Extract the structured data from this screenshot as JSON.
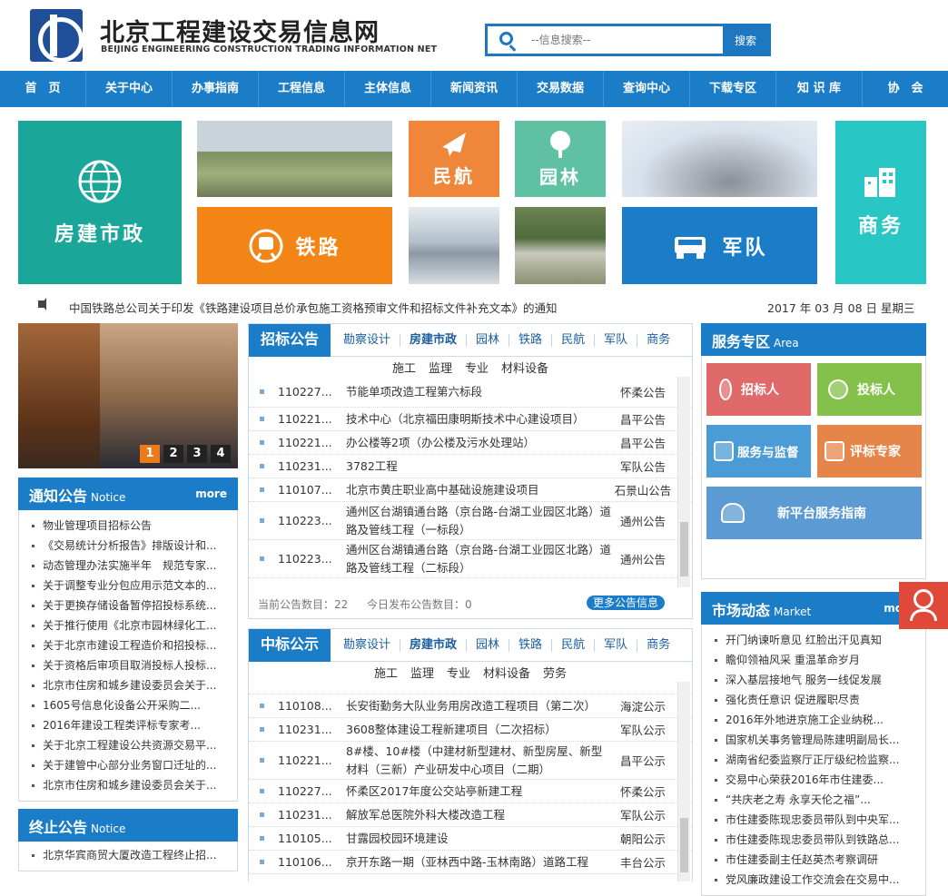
{
  "header": {
    "title": "北京工程建设交易信息网",
    "subtitle": "BEIJING ENGINEERING CONSTRUCTION TRADING INFORMATION NET",
    "search_placeholder": "--信息搜索--",
    "search_button": "搜索"
  },
  "nav": [
    "首　页",
    "关于中心",
    "办事指南",
    "工程信息",
    "主体信息",
    "新闻资讯",
    "交易数据",
    "查询中心",
    "下载专区",
    "知 识 库",
    "协　会"
  ],
  "tiles": {
    "fangjian": "房建市政",
    "minhang": "民航",
    "yuanlin": "园林",
    "tielu": "铁路",
    "jundui": "军队",
    "shangwu": "商务"
  },
  "ticker": {
    "text": "中国铁路总公司关于印发《铁路建设项目总价承包施工资格预审文件和招标文件补充文本》的通知",
    "date": "2017 年 03 月 08 日 星期三"
  },
  "slider": {
    "pages": [
      "1",
      "2",
      "3",
      "4"
    ],
    "active": 0
  },
  "notice": {
    "title": "通知公告",
    "title_en": "Notice",
    "more": "more",
    "items": [
      "物业管理项目招标公告",
      "《交易统计分析报告》排版设计和...",
      "动态管理办法实施半年　规范专家...",
      "关于调整专业分包应用示范文本的...",
      "关于更换存储设备暂停招投标系统...",
      "关于推行使用《北京市园林绿化工...",
      "关于北京市建设工程造价和招投标...",
      "关于资格后审项目取消投标人投标...",
      "北京市住房和城乡建设委员会关于...",
      "1605号信息化设备公开采购二...",
      "2016年建设工程类评标专家考...",
      "关于北京工程建设公共资源交易平...",
      "关于建管中心部分业务窗口迁址的...",
      "北京市住房和城乡建设委员会关于..."
    ]
  },
  "termination": {
    "title": "终止公告",
    "title_en": "Notice",
    "items": [
      "北京华宾商贸大厦改造工程终止招..."
    ]
  },
  "bid": {
    "title": "招标公告",
    "tabs": [
      "勘察设计",
      "房建市政",
      "园林",
      "铁路",
      "民航",
      "军队",
      "商务"
    ],
    "active_tab": 1,
    "subtabs": [
      "施工",
      "监理",
      "专业",
      "材料设备"
    ],
    "rows": [
      {
        "id": "110227...",
        "name": "节能单项改造工程第六标段",
        "area": "怀柔公告"
      },
      {
        "id": "110221...",
        "name": "技术中心（北京福田康明斯技术中心建设项目）",
        "area": "昌平公告"
      },
      {
        "id": "110221...",
        "name": "办公楼等2项（办公楼及污水处理站）",
        "area": "昌平公告"
      },
      {
        "id": "110231...",
        "name": "3782工程",
        "area": "军队公告"
      },
      {
        "id": "110107...",
        "name": "北京市黄庄职业高中基础设施建设项目",
        "area": "石景山公告"
      },
      {
        "id": "110223...",
        "name": "通州区台湖镇通台路（京台路-台湖工业园区北路）道路及管线工程（一标段）",
        "area": "通州公告"
      },
      {
        "id": "110223...",
        "name": "通州区台湖镇通台路（京台路-台湖工业园区北路）道路及管线工程（二标段）",
        "area": "通州公告"
      }
    ],
    "footer_count": "当前公告数目：22",
    "footer_today": "今日发布公告数目：0",
    "more_button": "更多公告信息"
  },
  "award": {
    "title": "中标公示",
    "tabs": [
      "勘察设计",
      "房建市政",
      "园林",
      "铁路",
      "民航",
      "军队",
      "商务"
    ],
    "active_tab": 1,
    "subtabs": [
      "施工",
      "监理",
      "专业",
      "材料设备",
      "劳务"
    ],
    "rows": [
      {
        "id": "110108...",
        "name": "长安街勤务大队业务用房改造工程项目（第二次）",
        "area": "海淀公示"
      },
      {
        "id": "110231...",
        "name": "3608整体建设工程新建项目（二次招标）",
        "area": "军队公示"
      },
      {
        "id": "110221...",
        "name": "8#楼、10#楼（中建材新型建材、新型房屋、新型材料（三新）产业研发中心项目（二期）",
        "area": "昌平公示"
      },
      {
        "id": "110227...",
        "name": "怀柔区2017年度公交站亭新建工程",
        "area": "怀柔公示"
      },
      {
        "id": "110231...",
        "name": "解放军总医院外科大楼改造工程",
        "area": "军队公示"
      },
      {
        "id": "110105...",
        "name": "甘露园校园环境建设",
        "area": "朝阳公示"
      },
      {
        "id": "110106...",
        "name": "京开东路一期（亚林西中路-玉林南路）道路工程",
        "area": "丰台公示"
      }
    ]
  },
  "service": {
    "title": "服务专区",
    "title_en": "Area",
    "buttons": {
      "tenderer": "招标人",
      "bidder": "投标人",
      "supervise": "服务与监督",
      "expert": "评标专家",
      "guide": "新平台服务指南"
    },
    "colors": {
      "tenderer": "#e06a6a",
      "bidder": "#84c14a",
      "supervise": "#4a9bd6",
      "expert": "#e5854a",
      "guide": "#5b9ad2"
    }
  },
  "market": {
    "title": "市场动态",
    "title_en": "Market",
    "more": "more",
    "items": [
      "开门纳谏听意见 红脸出汗见真知",
      "瞻仰领袖风采 重温革命岁月",
      "深入基层接地气 服务一线促发展",
      "强化责任意识 促进履职尽责",
      "2016年外地进京施工企业纳税...",
      "国家机关事务管理局陈建明副局长...",
      "湖南省纪委监察厅正厅级纪检监察...",
      "交易中心荣获2016年市住建委...",
      "“共庆老之寿 永享天伦之福”...",
      "市住建委陈现忠委员带队到中央军...",
      "市住建委陈现忠委员带队到铁路总...",
      "市住建委副主任赵英杰考察调研",
      "党风廉政建设工作交流会在交易中..."
    ]
  }
}
